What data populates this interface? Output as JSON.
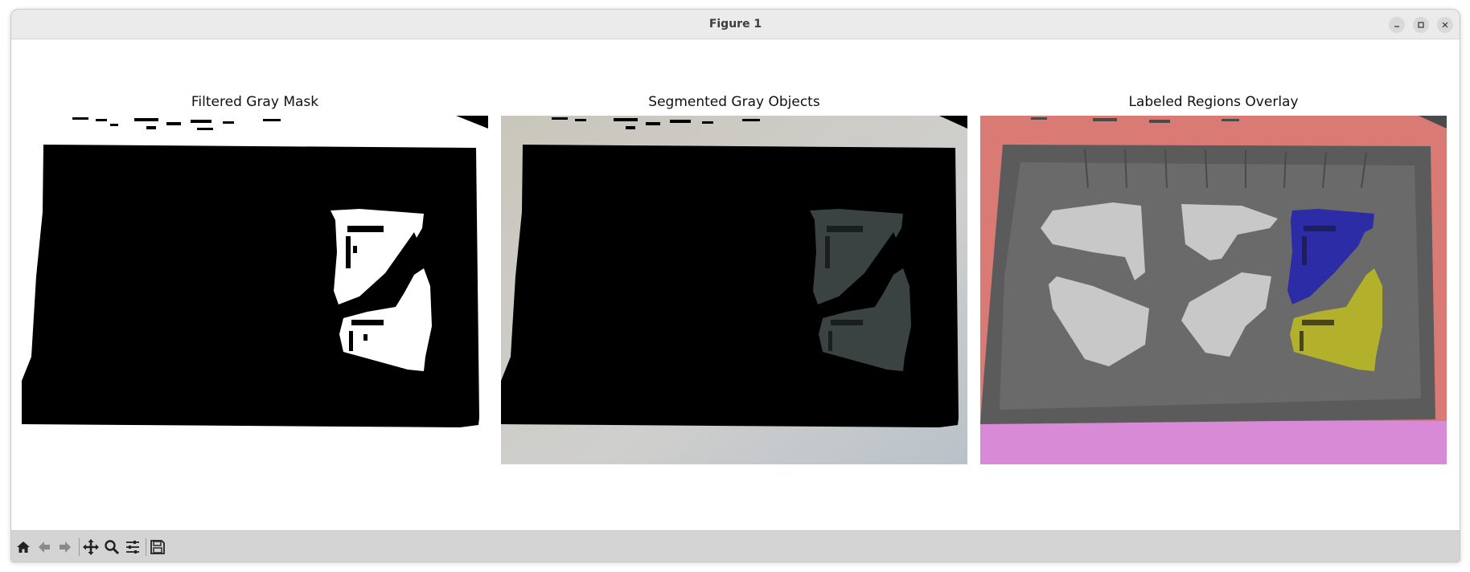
{
  "window": {
    "title": "Figure 1"
  },
  "window_controls": {
    "minimize": "minimize",
    "maximize": "maximize",
    "close": "close"
  },
  "subplots": [
    {
      "title": "Filtered Gray Mask"
    },
    {
      "title": "Segmented Gray Objects"
    },
    {
      "title": "Labeled Regions Overlay"
    }
  ],
  "toolbar": {
    "buttons": [
      "home-icon",
      "back-arrow-icon",
      "forward-arrow-icon",
      "pan-icon",
      "zoom-icon",
      "configure-subplots-icon",
      "save-icon"
    ]
  },
  "colors": {
    "mask_white": "#ffffff",
    "mask_black": "#000000",
    "overlay_red": "#d97a75",
    "overlay_magenta": "#d98ad6",
    "overlay_blue": "#2c2ca6",
    "overlay_yellow": "#b3b02c",
    "tray_gray": "#5a5a5a",
    "part_light": "#c8c8c8"
  }
}
